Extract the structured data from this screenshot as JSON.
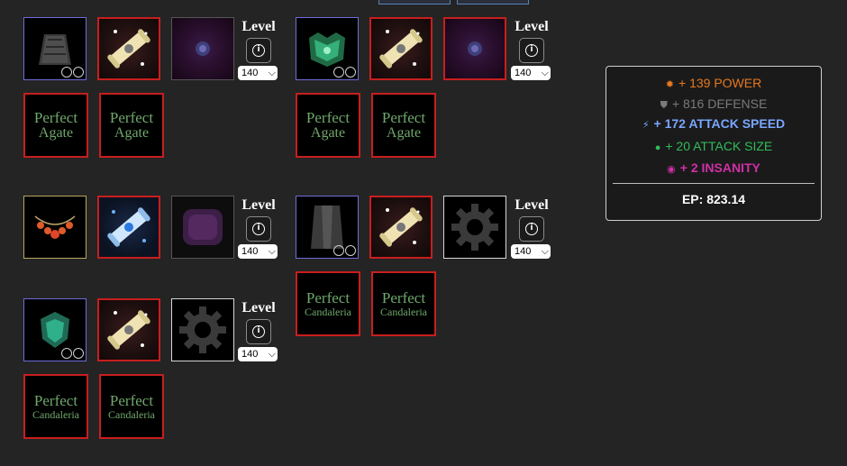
{
  "builds": [
    {
      "level": {
        "label": "Level",
        "value": "140"
      },
      "perfect": [
        {
          "word": "Perfect",
          "gem": "Agate"
        },
        {
          "word": "Perfect",
          "gem": "Agate"
        }
      ]
    },
    {
      "level": {
        "label": "Level",
        "value": "140"
      },
      "perfect": [
        {
          "word": "Perfect",
          "gem": "Agate"
        },
        {
          "word": "Perfect",
          "gem": "Agate"
        }
      ]
    },
    {
      "level": {
        "label": "Level",
        "value": "140"
      }
    },
    {
      "level": {
        "label": "Level",
        "value": "140"
      },
      "perfect": [
        {
          "word": "Perfect",
          "gem": "Candaleria"
        },
        {
          "word": "Perfect",
          "gem": "Candaleria"
        }
      ]
    },
    {
      "level": {
        "label": "Level",
        "value": "140"
      },
      "perfect": [
        {
          "word": "Perfect",
          "gem": "Candaleria"
        },
        {
          "word": "Perfect",
          "gem": "Candaleria"
        }
      ]
    }
  ],
  "stats": [
    {
      "text": "+ 139 POWER",
      "color": "#e8781e",
      "icon": "star-icon"
    },
    {
      "text": "+ 816 DEFENSE",
      "color": "#7a7a7a",
      "icon": "shield-icon"
    },
    {
      "text": "+ 172 ATTACK SPEED",
      "color": "#7aa6ff",
      "icon": "speed-icon"
    },
    {
      "text": "+ 20 ATTACK SIZE",
      "color": "#2fbd5a",
      "icon": "planet-icon"
    },
    {
      "text": "+ 2 INSANITY",
      "color": "#d02fa6",
      "icon": "eye-icon"
    }
  ],
  "ep": "EP: 823.14"
}
